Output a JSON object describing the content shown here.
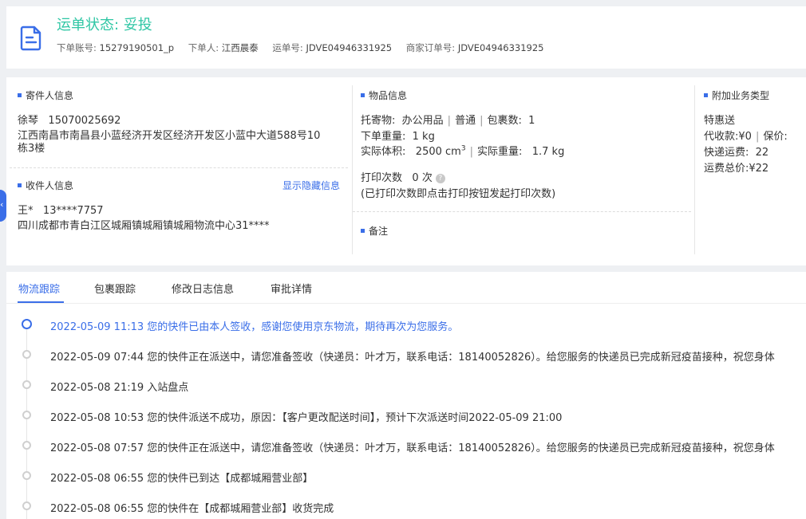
{
  "header": {
    "status_label": "运单状态:",
    "status_value": "妥投",
    "order_account_label": "下单账号:",
    "order_account": "15279190501_p",
    "orderer_label": "下单人:",
    "orderer": "江西晨泰",
    "waybill_label": "运单号:",
    "waybill": "JDVE04946331925",
    "merchant_order_label": "商家订单号:",
    "merchant_order": "JDVE04946331925"
  },
  "sender": {
    "title": "寄件人信息",
    "name": "徐琴",
    "phone": "15070025692",
    "address_line1": "江西南昌市南昌县小蓝经济开发区经济开发区小蓝中大道588号10",
    "address_line2": "栋3楼"
  },
  "receiver": {
    "title": "收件人信息",
    "show_hidden_link": "显示隐藏信息",
    "name": "王*",
    "phone": "13****7757",
    "address": "四川成都市青白江区城厢镇城厢镇城厢物流中心31****"
  },
  "goods": {
    "title": "物品信息",
    "consignment_label": "托寄物:",
    "consignment_value": "办公用品",
    "type": "普通",
    "package_count_label": "包裹数:",
    "package_count": "1",
    "order_weight_label": "下单重量:",
    "order_weight": "1 kg",
    "actual_volume_label": "实际体积:",
    "actual_volume": "2500 cm",
    "volume_sup": "3",
    "actual_weight_label": "实际重量:",
    "actual_weight": "1.7 kg",
    "print_count_label": "打印次数",
    "print_count": "0 次",
    "print_hint": "(已打印次数即点击打印按钮发起打印次数)",
    "remarks_title": "备注"
  },
  "extra": {
    "title": "附加业务类型",
    "service": "特惠送",
    "cod_label": "代收款:",
    "cod_value": "¥0",
    "insurance_label": "保价:",
    "insurance_value": "",
    "express_fee_label": "快递运费:",
    "express_fee": "22",
    "total_fee_label": "运费总价:",
    "total_fee": "¥22"
  },
  "tabs": [
    "物流跟踪",
    "包裹跟踪",
    "修改日志信息",
    "审批详情"
  ],
  "timeline": [
    "2022-05-09 11:13 您的快件已由本人签收，感谢您使用京东物流，期待再次为您服务。",
    "2022-05-09 07:44 您的快件正在派送中，请您准备签收（快递员：叶才万，联系电话：18140052826）。给您服务的快递员已完成新冠疫苗接种，祝您身体",
    "2022-05-08 21:19 入站盘点",
    "2022-05-08 10:53 您的快件派送不成功，原因：【客户更改配送时间】，预计下次派送时间2022-05-09 21:00",
    "2022-05-08 07:57 您的快件正在派送中，请您准备签收（快递员：叶才万，联系电话：18140052826）。给您服务的快递员已完成新冠疫苗接种，祝您身体",
    "2022-05-08 06:55 您的快件已到达【成都城厢营业部】",
    "2022-05-08 06:55 您的快件在【成都城厢营业部】收货完成"
  ],
  "colors": {
    "accent": "#3a6ee8",
    "status": "#2ec6a4"
  }
}
